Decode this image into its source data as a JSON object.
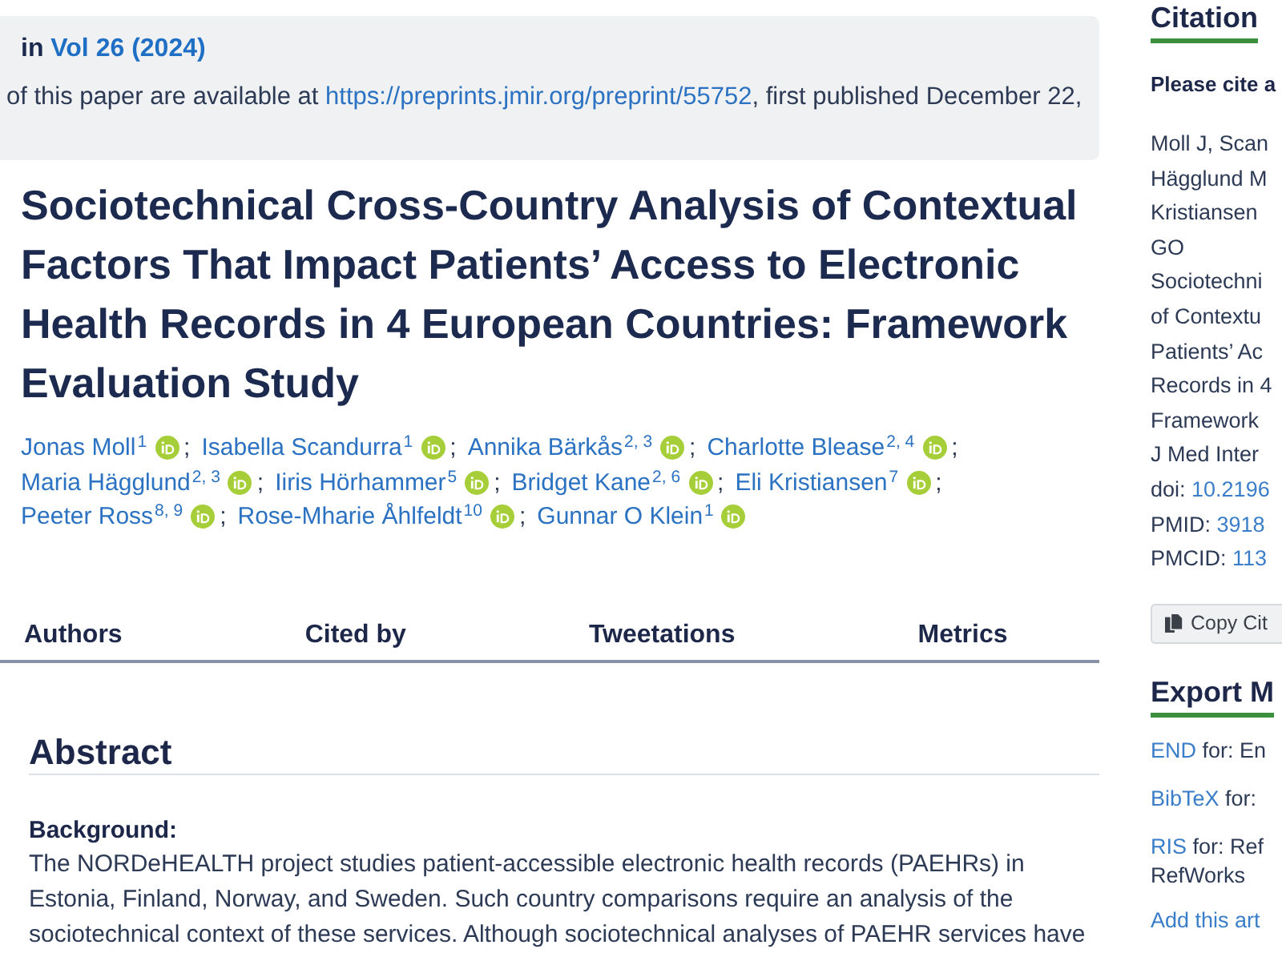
{
  "publication_notice": {
    "prefix": "in",
    "volume_link": "Vol 26 (2024)",
    "preprint_text": "of this paper are available at",
    "preprint_link": "https://preprints.jmir.org/preprint/55752",
    "preprint_suffix": ", first published December 22,"
  },
  "article": {
    "title": "Sociotechnical Cross-Country Analysis of Contextual Factors That Impact Patients’ Access to Electronic Health Records in 4 European Countries: Framework Evaluation Study",
    "authors": [
      {
        "name": "Jonas Moll",
        "affiliations": "1",
        "separator": ";"
      },
      {
        "name": "Isabella Scandurra",
        "affiliations": "1",
        "separator": ";"
      },
      {
        "name": "Annika Bärkås",
        "affiliations": "2, 3",
        "separator": ";"
      },
      {
        "name": "Charlotte Blease",
        "affiliations": "2, 4",
        "separator": ";"
      },
      {
        "name": "Maria Hägglund",
        "affiliations": "2, 3",
        "separator": ";"
      },
      {
        "name": "Iiris Hörhammer",
        "affiliations": "5",
        "separator": ";"
      },
      {
        "name": "Bridget Kane",
        "affiliations": "2, 6",
        "separator": ";"
      },
      {
        "name": "Eli Kristiansen",
        "affiliations": "7",
        "separator": ";"
      },
      {
        "name": "Peeter Ross",
        "affiliations": "8, 9",
        "separator": ";"
      },
      {
        "name": "Rose-Mharie Åhlfeldt",
        "affiliations": "10",
        "separator": ";"
      },
      {
        "name": "Gunnar O Klein",
        "affiliations": "1"
      }
    ]
  },
  "tabs": [
    {
      "label": "Authors",
      "selected": false
    },
    {
      "label": "Cited by",
      "selected": false
    },
    {
      "label": "Tweetations",
      "selected": false
    },
    {
      "label": "Metrics",
      "selected": false
    }
  ],
  "abstract": {
    "heading": "Abstract",
    "sections": [
      {
        "heading": "Background:",
        "text": "The NORDeHEALTH project studies patient-accessible electronic health records (PAEHRs) in Estonia, Finland, Norway, and Sweden. Such country comparisons require an analysis of the sociotechnical context of these services. Although sociotechnical analyses of PAEHR services have"
      }
    ]
  },
  "citation": {
    "heading": "Citation",
    "instruction": "Please cite a",
    "reference_lines": [
      "Moll J, Scan",
      "Hägglund M",
      "Kristiansen",
      "GO",
      "Sociotechni",
      "of Contextu",
      "Patients’ Ac",
      "Records in 4",
      "Framework",
      "J Med Inter"
    ],
    "identifiers": [
      {
        "label": "doi:",
        "value": "10.2196"
      },
      {
        "label": "PMID:",
        "value": "3918"
      },
      {
        "label": "PMCID:",
        "value": "113"
      }
    ],
    "copy_button": "Copy Cit"
  },
  "export": {
    "heading": "Export M",
    "options": [
      {
        "format": "END",
        "description_lines": [
          "for: En"
        ]
      },
      {
        "format": "BibTeX",
        "description_lines": [
          "for:"
        ]
      },
      {
        "format": "RIS",
        "description_lines": [
          "for: Ref",
          "RefWorks"
        ]
      }
    ],
    "add_link": "Add this art"
  }
}
